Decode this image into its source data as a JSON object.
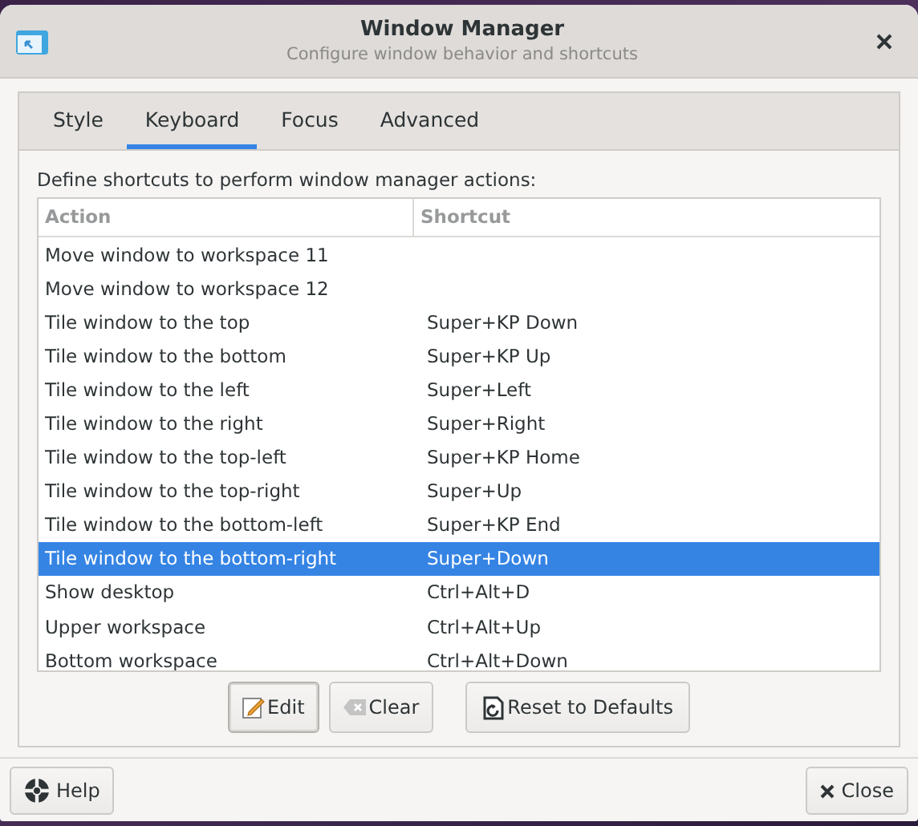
{
  "window": {
    "title": "Window Manager",
    "subtitle": "Configure window behavior and shortcuts"
  },
  "tabs": [
    {
      "label": "Style",
      "selected": false
    },
    {
      "label": "Keyboard",
      "selected": true
    },
    {
      "label": "Focus",
      "selected": false
    },
    {
      "label": "Advanced",
      "selected": false
    }
  ],
  "description": "Define shortcuts to perform window manager actions:",
  "table": {
    "columns": [
      "Action",
      "Shortcut"
    ],
    "rows": [
      {
        "action": "Move window to workspace 11",
        "shortcut": "",
        "selected": false
      },
      {
        "action": "Move window to workspace 12",
        "shortcut": "",
        "selected": false
      },
      {
        "action": "Tile window to the top",
        "shortcut": "Super+KP Down",
        "selected": false
      },
      {
        "action": "Tile window to the bottom",
        "shortcut": "Super+KP Up",
        "selected": false
      },
      {
        "action": "Tile window to the left",
        "shortcut": "Super+Left",
        "selected": false
      },
      {
        "action": "Tile window to the right",
        "shortcut": "Super+Right",
        "selected": false
      },
      {
        "action": "Tile window to the top-left",
        "shortcut": "Super+KP Home",
        "selected": false
      },
      {
        "action": "Tile window to the top-right",
        "shortcut": "Super+Up",
        "selected": false
      },
      {
        "action": "Tile window to the bottom-left",
        "shortcut": "Super+KP End",
        "selected": false
      },
      {
        "action": "Tile window to the bottom-right",
        "shortcut": "Super+Down",
        "selected": true
      },
      {
        "action": "Show desktop",
        "shortcut": "Ctrl+Alt+D",
        "selected": false
      },
      {
        "action": "Upper workspace",
        "shortcut": "Ctrl+Alt+Up",
        "selected": false
      },
      {
        "action": "Bottom workspace",
        "shortcut": "Ctrl+Alt+Down",
        "selected": false
      }
    ]
  },
  "actions": [
    {
      "kind": "edit",
      "label": "Edit"
    },
    {
      "kind": "clear",
      "label": "Clear"
    },
    {
      "kind": "reset",
      "label": "Reset to Defaults"
    }
  ],
  "footer": {
    "help": "Help",
    "close": "Close"
  }
}
